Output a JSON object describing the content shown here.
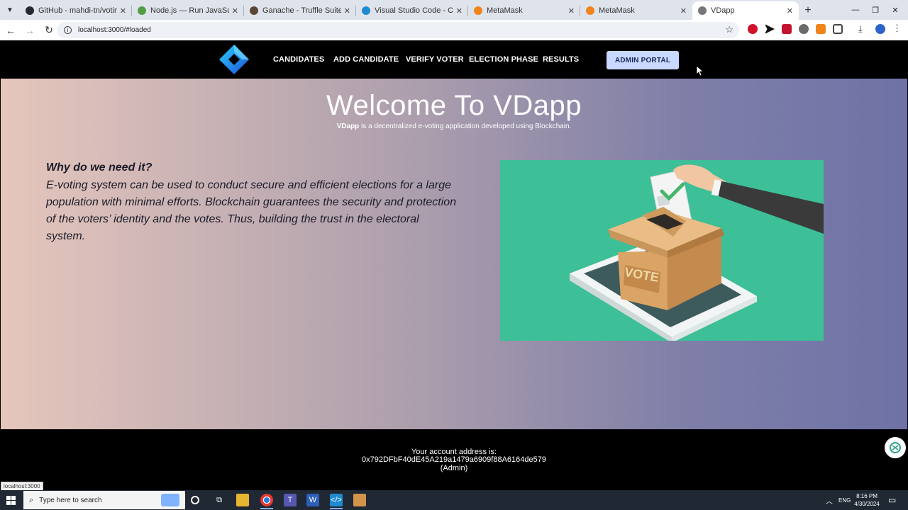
{
  "browser": {
    "tabs": [
      {
        "title": "GitHub - mahdi-tn/voting-dapp",
        "favicon_color": "#24292f"
      },
      {
        "title": "Node.js — Run JavaScript Everywhere",
        "favicon_color": "#539e43"
      },
      {
        "title": "Ganache - Truffle Suite",
        "favicon_color": "#5b4636"
      },
      {
        "title": "Visual Studio Code - Code Editing",
        "favicon_color": "#1f8ad2"
      },
      {
        "title": "MetaMask",
        "favicon_color": "#f0841a"
      },
      {
        "title": "MetaMask",
        "favicon_color": "#f0841a"
      },
      {
        "title": "VDapp",
        "favicon_color": "#777777"
      }
    ],
    "url": "localhost:3000/#loaded",
    "status_url": "localhost:3000"
  },
  "nav": {
    "links": [
      "CANDIDATES",
      "ADD CANDIDATE",
      "VERIFY VOTER",
      "ELECTION PHASE",
      "RESULTS"
    ],
    "admin_button": "ADMIN PORTAL"
  },
  "hero": {
    "title": "Welcome To VDapp",
    "subtitle_brand": "VDapp",
    "subtitle_rest": " is a decentralized e-voting application developed using Blockchain.",
    "why_title": "Why do we need it?",
    "why_body": "E-voting system can be used to conduct secure and efficient elections for a large population with minimal efforts. Blockchain guarantees the security and protection of the voters’ identity and the votes. Thus, building the trust in the electoral system.",
    "ballot_text": "VOTE"
  },
  "footer": {
    "line1": "Your account address is:",
    "address": "0x792DFbF40dE45A219a1479a6909f88A6164de579",
    "role": "(Admin)"
  },
  "taskbar": {
    "search_placeholder": "Type here to search",
    "lang": "ENG",
    "time": "8:16 PM",
    "date": "4/30/2024"
  },
  "colors": {
    "nav_bg": "#000000",
    "admin_button_bg": "#c8d8ff",
    "illustration_bg": "#3dbf98"
  }
}
